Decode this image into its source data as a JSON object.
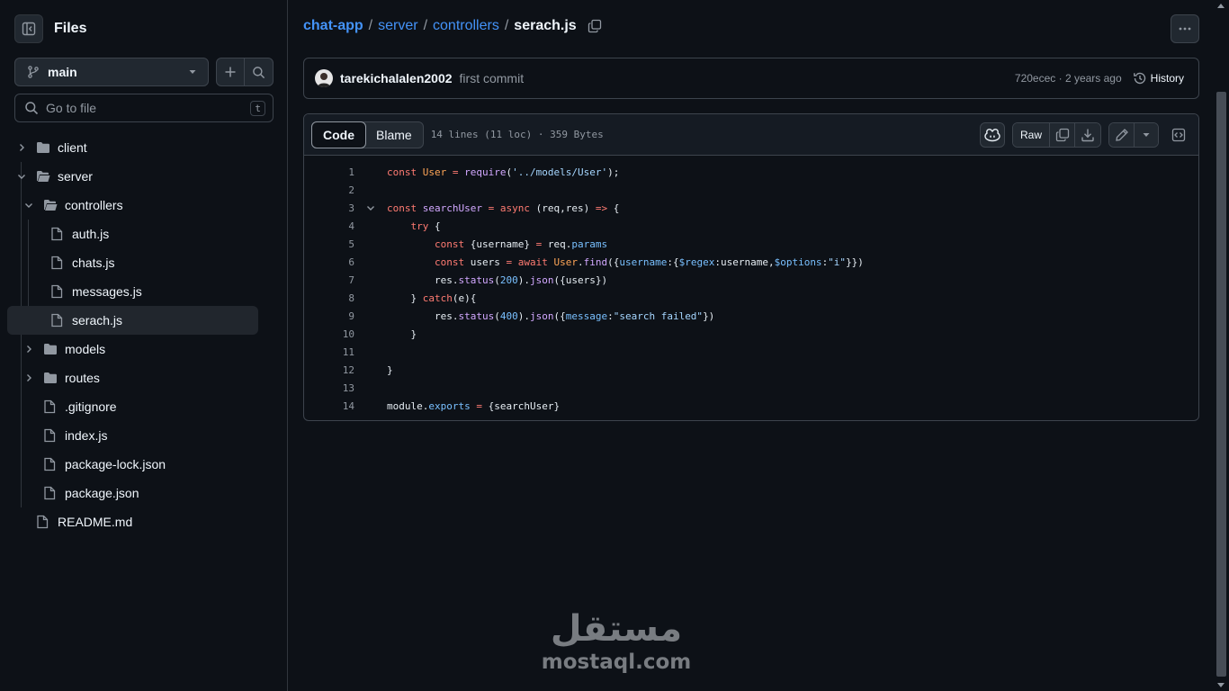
{
  "sidebar": {
    "title": "Files",
    "branch": "main",
    "goto_placeholder": "Go to file",
    "goto_shortcut": "t",
    "tree": {
      "client": "client",
      "server": "server",
      "controllers": "controllers",
      "auth": "auth.js",
      "chats": "chats.js",
      "messages": "messages.js",
      "serach": "serach.js",
      "models": "models",
      "routes": "routes",
      "gitignore": ".gitignore",
      "index": "index.js",
      "package_lock": "package-lock.json",
      "package": "package.json",
      "readme": "README.md"
    }
  },
  "breadcrumb": {
    "repo": "chat-app",
    "dir1": "server",
    "dir2": "controllers",
    "file": "serach.js",
    "separator": "/"
  },
  "commit": {
    "author": "tarekichalalen2002",
    "message": "first commit",
    "meta": "720ecec · 2 years ago",
    "history_label": "History"
  },
  "file_header": {
    "tab_code": "Code",
    "tab_blame": "Blame",
    "info": "14 lines (11 loc) · 359 Bytes",
    "raw_label": "Raw"
  },
  "code_lines": [
    "1",
    "2",
    "3",
    "4",
    "5",
    "6",
    "7",
    "8",
    "9",
    "10",
    "11",
    "12",
    "13",
    "14"
  ],
  "code": {
    "l1": [
      "const",
      "User",
      "=",
      "require",
      "(",
      "'../models/User'",
      ");"
    ],
    "l3": [
      "const",
      "searchUser",
      "=",
      "async",
      "(req,res)",
      "=>",
      "{"
    ],
    "l4": [
      "try",
      "{"
    ],
    "l5": [
      "const",
      "{username}",
      "=",
      "req.",
      "params"
    ],
    "l6": [
      "const",
      "users",
      "=",
      "await",
      "User",
      ".",
      "find",
      "({",
      "username",
      ":{",
      "$regex",
      ":username,",
      "$options",
      ":",
      "\"i\"",
      "}})"
    ],
    "l7": [
      "res.",
      "status",
      "(",
      "200",
      ").",
      "json",
      "({users})"
    ],
    "l8": [
      "}",
      "catch",
      "(e){"
    ],
    "l9": [
      "res.",
      "status",
      "(",
      "400",
      ").",
      "json",
      "({",
      "message",
      ":",
      "\"search failed\"",
      "})"
    ],
    "l10": [
      "}"
    ],
    "l12": [
      "}"
    ],
    "l14": [
      "module.",
      "exports",
      "=",
      "{searchUser}"
    ]
  },
  "watermark": {
    "arabic": "مستقل",
    "latin": "mostaql.com"
  },
  "colors": {
    "accent": "#4493f8",
    "keyword": "#ff7b72",
    "function": "#d2a8ff",
    "string": "#a5d6ff",
    "constant": "#79c0ff",
    "entity": "#ffa657"
  }
}
